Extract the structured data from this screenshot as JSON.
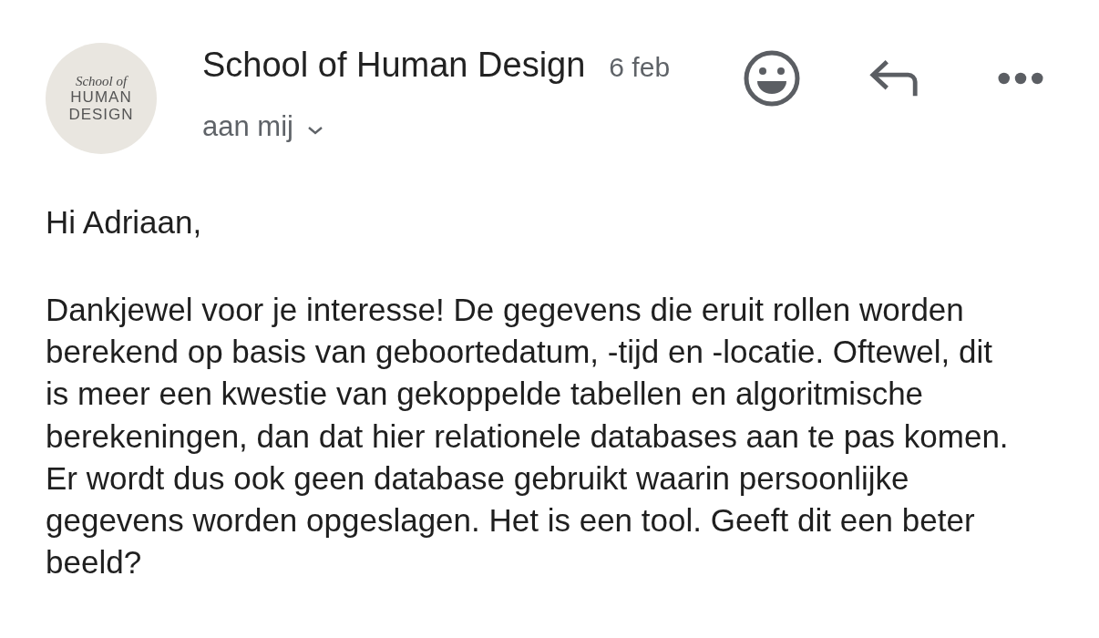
{
  "sender": {
    "avatar": {
      "lines": [
        "School of",
        "HUMAN",
        "DESIGN"
      ]
    },
    "name": "School of Human Design",
    "date": "6 feb",
    "recipient": "aan mij"
  },
  "body": {
    "greeting": "Hi Adriaan,",
    "paragraph": "Dankjewel voor je interesse! De gegevens die eruit rollen worden berekend op basis van geboortedatum, -tijd en -locatie. Oftewel, dit is meer een kwestie van gekoppelde tabellen en algoritmische berekeningen, dan dat hier relationele databases aan te pas komen. Er wordt dus ook geen database gebruikt waarin persoonlijke gegevens worden opgeslagen. Het is een tool. Geeft dit een beter beeld?"
  }
}
